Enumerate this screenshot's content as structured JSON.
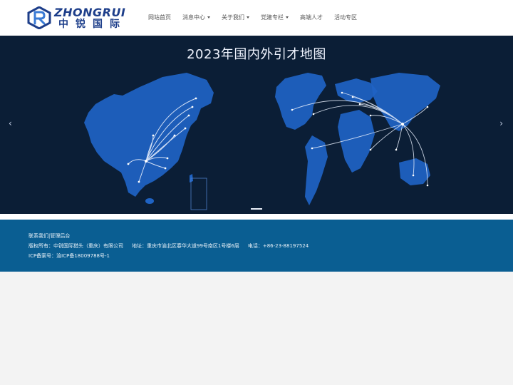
{
  "logo": {
    "english": "ZHONGRUI",
    "chinese": "中锐国际",
    "brand_color": "#1d3e8a",
    "accent_color": "#3a7bd5"
  },
  "nav": {
    "items": [
      {
        "label": "网站首页",
        "has_dropdown": false
      },
      {
        "label": "消息中心",
        "has_dropdown": true
      },
      {
        "label": "关于我们",
        "has_dropdown": true
      },
      {
        "label": "党建专栏",
        "has_dropdown": true
      },
      {
        "label": "高端人才",
        "has_dropdown": false
      },
      {
        "label": "活动专区",
        "has_dropdown": false
      }
    ]
  },
  "banner": {
    "title": "2023年国内外引才地图",
    "background_color": "#0b1e36",
    "map_color": "#1f63c4",
    "arrow_left": "‹",
    "arrow_right": "›"
  },
  "footer": {
    "links": [
      "联系我们",
      "管理后台"
    ],
    "link_separator": "|",
    "copyright": "版权所有：中锐国际猎头（重庆）有限公司",
    "address": "地址：重庆市渝北区春华大道99号南区1号楼6层",
    "phone": "电话：+86-23-88197524",
    "icp": "ICP备案号：渝ICP备18009788号-1",
    "background_color": "#0a5e92"
  }
}
